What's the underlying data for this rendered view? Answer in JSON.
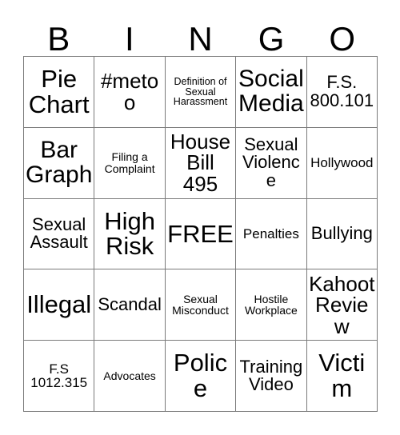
{
  "card": {
    "title_letters": [
      "B",
      "I",
      "N",
      "G",
      "O"
    ],
    "grid_size": 5,
    "free_space_index": 12,
    "colors": {
      "background": "#ffffff",
      "text": "#000000",
      "border": "#7a7a7a"
    },
    "cells": [
      {
        "text": "Pie Chart",
        "size": "xl"
      },
      {
        "text": "#metoo",
        "size": "lg"
      },
      {
        "text": "Definition of Sexual Harassment",
        "size": "xxs"
      },
      {
        "text": "Social Media",
        "size": "xl"
      },
      {
        "text": "F.S. 800.101",
        "size": "md"
      },
      {
        "text": "Bar Graph",
        "size": "xl"
      },
      {
        "text": "Filing a Complaint",
        "size": "xs"
      },
      {
        "text": "House Bill 495",
        "size": "lg"
      },
      {
        "text": "Sexual Violence",
        "size": "md"
      },
      {
        "text": "Hollywood",
        "size": "sm"
      },
      {
        "text": "Sexual Assault",
        "size": "md"
      },
      {
        "text": "High Risk",
        "size": "xl"
      },
      {
        "text": "FREE",
        "size": "xl"
      },
      {
        "text": "Penalties",
        "size": "sm"
      },
      {
        "text": "Bullying",
        "size": "md"
      },
      {
        "text": "Illegal",
        "size": "xl"
      },
      {
        "text": "Scandal",
        "size": "md"
      },
      {
        "text": "Sexual Misconduct",
        "size": "xs"
      },
      {
        "text": "Hostile Workplace",
        "size": "xs"
      },
      {
        "text": "Kahoot Review",
        "size": "lg"
      },
      {
        "text": "F.S 1012.315",
        "size": "sm"
      },
      {
        "text": "Advocates",
        "size": "xs"
      },
      {
        "text": "Police",
        "size": "xl"
      },
      {
        "text": "Training Video",
        "size": "md"
      },
      {
        "text": "Victim",
        "size": "xl"
      }
    ]
  }
}
